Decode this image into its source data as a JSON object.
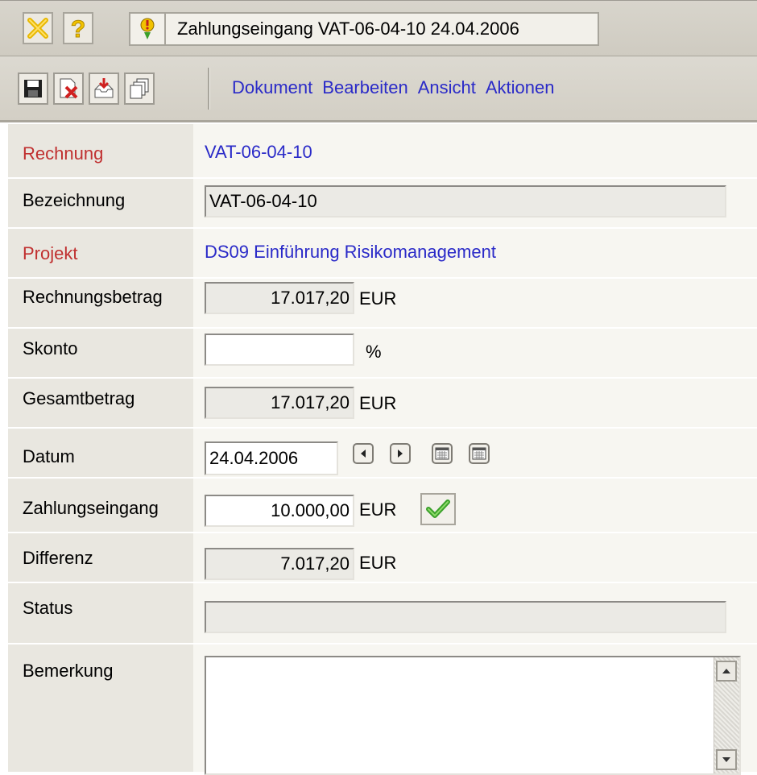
{
  "window": {
    "title": "Zahlungseingang VAT-06-04-10 24.04.2006",
    "close_icon": "close-x-icon",
    "help_icon": "help-question-icon",
    "doc_icon": "document-alert-icon"
  },
  "toolbar": {
    "icons": [
      "save-disk-icon",
      "delete-doc-icon",
      "inbox-download-icon",
      "copy-pages-icon"
    ],
    "menu": [
      "Dokument",
      "Bearbeiten",
      "Ansicht",
      "Aktionen"
    ]
  },
  "form": {
    "rechnung_label": "Rechnung",
    "rechnung_value": "VAT-06-04-10",
    "bezeichnung_label": "Bezeichnung",
    "bezeichnung_value": "VAT-06-04-10",
    "projekt_label": "Projekt",
    "projekt_value": "DS09 Einführung Risikomanagement",
    "rechnungsbetrag_label": "Rechnungsbetrag",
    "rechnungsbetrag_value": "17.017,20",
    "rechnungsbetrag_unit": "EUR",
    "skonto_label": "Skonto",
    "skonto_value": "",
    "skonto_unit": "%",
    "gesamtbetrag_label": "Gesamtbetrag",
    "gesamtbetrag_value": "17.017,20",
    "gesamtbetrag_unit": "EUR",
    "datum_label": "Datum",
    "datum_value": "24.04.2006",
    "zahlungseingang_label": "Zahlungseingang",
    "zahlungseingang_value": "10.000,00",
    "zahlungseingang_unit": "EUR",
    "differenz_label": "Differenz",
    "differenz_value": "7.017,20",
    "differenz_unit": "EUR",
    "status_label": "Status",
    "status_value": "",
    "bemerkung_label": "Bemerkung",
    "bemerkung_value": ""
  },
  "colors": {
    "accent_link": "#2a2ac8",
    "required_label": "#c03030",
    "check_green": "#3aa02a"
  }
}
